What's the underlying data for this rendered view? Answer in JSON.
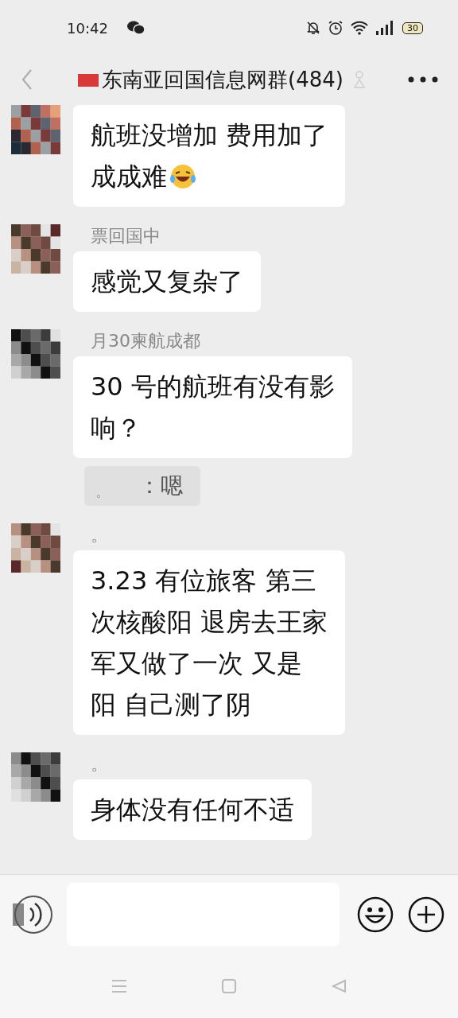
{
  "status_bar": {
    "time": "10:42",
    "battery": "30"
  },
  "header": {
    "title": "东南亚回国信息网群(484)"
  },
  "messages": [
    {
      "kind": "bubble",
      "lines": [
        "航班没增加 费用加了",
        "成成难"
      ],
      "emoji": true
    },
    {
      "kind": "bubble",
      "sender": "票回国中",
      "lines": [
        "感觉又复杂了"
      ],
      "emoji": false
    },
    {
      "kind": "bubble",
      "sender": "月30柬航成都",
      "lines": [
        "30 号的航班有没有影",
        "响？"
      ],
      "emoji": false
    },
    {
      "kind": "quote",
      "mark": "。",
      "text": "：嗯"
    },
    {
      "kind": "bubble",
      "sender": "。",
      "lines": [
        "3.23 有位旅客 第三",
        "次核酸阳 退房去王家",
        "军又做了一次 又是",
        "阳 自己测了阴"
      ],
      "emoji": false
    },
    {
      "kind": "bubble",
      "sender": "。",
      "lines": [
        "身体没有任何不适"
      ],
      "emoji": false
    }
  ]
}
